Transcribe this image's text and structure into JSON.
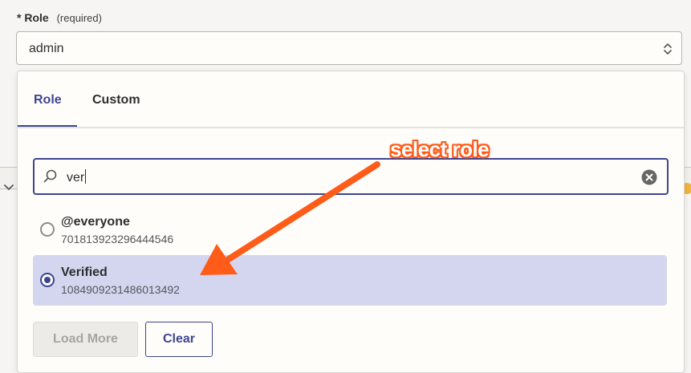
{
  "field": {
    "required_marker": "*",
    "label": "Role",
    "required_note": "(required)",
    "selected_value": "admin"
  },
  "dropdown": {
    "tabs": [
      {
        "label": "Role",
        "active": true
      },
      {
        "label": "Custom",
        "active": false
      }
    ],
    "search": {
      "query": "ver"
    },
    "options": [
      {
        "name": "@everyone",
        "id": "701813923296444546",
        "selected": false
      },
      {
        "name": "Verified",
        "id": "1084909231486013492",
        "selected": true
      }
    ],
    "buttons": {
      "load_more": "Load More",
      "clear": "Clear"
    }
  },
  "annotation": {
    "text": "select role",
    "color": "#ff5c1a"
  },
  "colors": {
    "accent": "#3d4592",
    "selected_row": "#d4d6f0",
    "panel_bg": "#fffdf9"
  },
  "icons": {
    "select_toggle": "updown-chevrons-icon",
    "search": "search-icon",
    "clear": "clear-circle-icon",
    "background_chevron": "chevron-down-icon"
  }
}
